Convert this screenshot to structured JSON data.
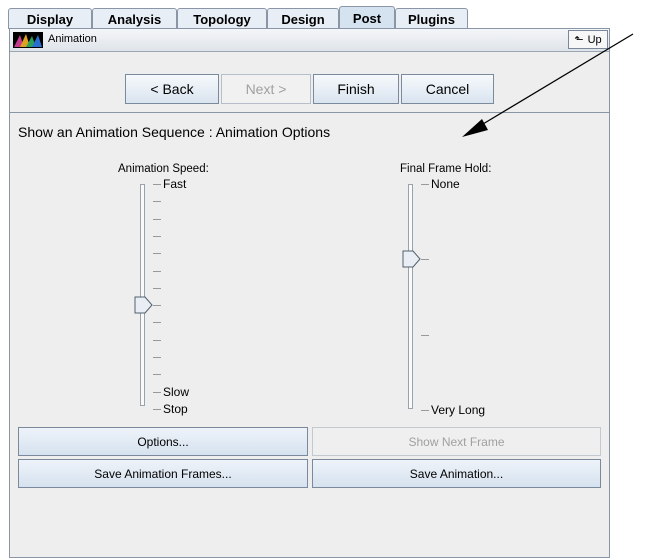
{
  "tabs": [
    "Display",
    "Analysis",
    "Topology",
    "Design",
    "Post",
    "Plugins"
  ],
  "active_tab": "Post",
  "panel": {
    "title": "Animation",
    "up_label": "Up"
  },
  "nav": {
    "back": "< Back",
    "next": "Next >",
    "finish": "Finish",
    "cancel": "Cancel"
  },
  "heading": "Show an Animation Sequence : Animation Options",
  "speed_slider": {
    "label": "Animation Speed:",
    "top_label": "Fast",
    "bottom_labels": [
      "Slow",
      "Stop"
    ],
    "value_step": 7,
    "steps": 14
  },
  "hold_slider": {
    "label": "Final Frame Hold:",
    "top_label": "None",
    "bottom_label": "Very Long",
    "value_step": 1,
    "steps": 3
  },
  "buttons": {
    "options": "Options...",
    "show_next_frame": "Show Next Frame",
    "save_frames": "Save Animation Frames...",
    "save_animation": "Save Animation..."
  },
  "colors": {
    "tab_active": "#d5e2f0",
    "button_top": "#eef3f9",
    "button_bottom": "#d6e2ef",
    "disabled_text": "#a0a0a0"
  }
}
